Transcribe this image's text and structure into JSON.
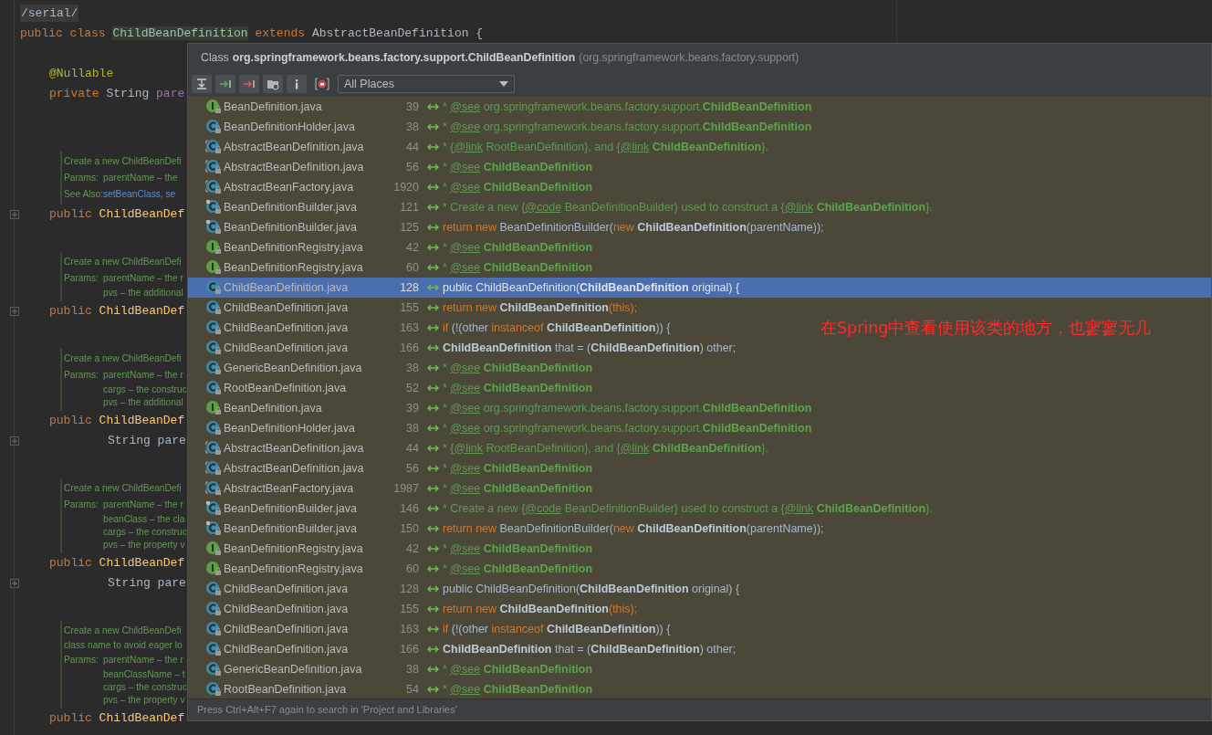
{
  "editor": {
    "lines": [
      {
        "kind": "top",
        "fold": false,
        "highlight": true,
        "segments": [
          {
            "kind": "p",
            "text": "/serial/"
          }
        ]
      },
      {
        "kind": "top",
        "fold": false,
        "highlight": false,
        "segments": [
          {
            "kind": "k",
            "text": "public class "
          },
          {
            "kind": "hl",
            "text": "ChildBeanDefinition"
          },
          {
            "kind": "k",
            "text": " extends "
          },
          {
            "kind": "p",
            "text": "AbstractBeanDefinition {"
          }
        ]
      },
      {
        "kind": "blank"
      },
      {
        "kind": "member",
        "fold": false,
        "highlight": false,
        "segments": [
          {
            "kind": "a",
            "text": "@Nullable"
          }
        ]
      },
      {
        "kind": "member",
        "fold": false,
        "highlight": false,
        "segments": [
          {
            "kind": "k",
            "text": "private "
          },
          {
            "kind": "p",
            "text": "String "
          },
          {
            "kind": "f",
            "text": "pare"
          }
        ]
      },
      {
        "kind": "blank"
      },
      {
        "kind": "blank"
      },
      {
        "kind": "doc",
        "lines": [
          {
            "kind": "text",
            "text": "Create a new ChildBeanDefi"
          },
          {
            "kind": "param",
            "label": "Params:",
            "text": "parentName – the"
          },
          {
            "kind": "link",
            "label": "See Also:",
            "text": "setBeanClass, se"
          }
        ]
      },
      {
        "kind": "member",
        "fold": true,
        "highlight": false,
        "segments": [
          {
            "kind": "k",
            "text": "public "
          },
          {
            "kind": "m",
            "text": "ChildBeanDef"
          }
        ]
      },
      {
        "kind": "blank"
      },
      {
        "kind": "doc",
        "lines": [
          {
            "kind": "text",
            "text": "Create a new ChildBeanDefi"
          },
          {
            "kind": "param",
            "label": "Params:",
            "text": "parentName – the r"
          },
          {
            "kind": "more",
            "text": "pvs – the additional"
          }
        ]
      },
      {
        "kind": "member",
        "fold": true,
        "highlight": false,
        "segments": [
          {
            "kind": "k",
            "text": "public "
          },
          {
            "kind": "m",
            "text": "ChildBeanDef"
          }
        ]
      },
      {
        "kind": "blank"
      },
      {
        "kind": "doc",
        "lines": [
          {
            "kind": "text",
            "text": "Create a new ChildBeanDefi"
          },
          {
            "kind": "param",
            "label": "Params:",
            "text": "parentName – the r"
          },
          {
            "kind": "more",
            "text": "cargs – the construc"
          },
          {
            "kind": "more",
            "text": "pvs – the additional"
          }
        ]
      },
      {
        "kind": "member",
        "fold": false,
        "highlight": false,
        "segments": [
          {
            "kind": "k",
            "text": "public "
          },
          {
            "kind": "m",
            "text": "ChildBeanDef"
          }
        ]
      },
      {
        "kind": "continued",
        "fold": true,
        "highlight": false,
        "segments": [
          {
            "kind": "p",
            "text": "String pare"
          }
        ]
      },
      {
        "kind": "blank"
      },
      {
        "kind": "doc",
        "lines": [
          {
            "kind": "text",
            "text": "Create a new ChildBeanDefi"
          },
          {
            "kind": "param",
            "label": "Params:",
            "text": "parentName – the r"
          },
          {
            "kind": "more",
            "text": "beanClass – the cla"
          },
          {
            "kind": "more",
            "text": "cargs – the construc"
          },
          {
            "kind": "more",
            "text": "pvs – the property v"
          }
        ]
      },
      {
        "kind": "member",
        "fold": false,
        "highlight": false,
        "segments": [
          {
            "kind": "k",
            "text": "public "
          },
          {
            "kind": "m",
            "text": "ChildBeanDef"
          }
        ]
      },
      {
        "kind": "continued",
        "fold": true,
        "highlight": false,
        "segments": [
          {
            "kind": "p",
            "text": "String pare"
          }
        ]
      },
      {
        "kind": "blank"
      },
      {
        "kind": "doc",
        "lines": [
          {
            "kind": "text",
            "text": "Create a new ChildBeanDefi"
          },
          {
            "kind": "wrapped",
            "text": "class name to avoid eager lo"
          },
          {
            "kind": "param",
            "label": "Params:",
            "text": "parentName – the r"
          },
          {
            "kind": "more",
            "text": "beanClassName – t"
          },
          {
            "kind": "more",
            "text": "cargs – the construc"
          },
          {
            "kind": "more",
            "text": "pvs – the property v"
          }
        ]
      },
      {
        "kind": "member",
        "fold": false,
        "highlight": false,
        "segments": [
          {
            "kind": "k",
            "text": "public "
          },
          {
            "kind": "m",
            "text": "ChildBeanDef"
          }
        ]
      }
    ]
  },
  "popup": {
    "header": {
      "kind": "Class",
      "name": "org.springframework.beans.factory.support.ChildBeanDefinition",
      "package": "(org.springframework.beans.factory.support)"
    },
    "scope": "All Places",
    "rows": [
      {
        "kind": "interface",
        "file": "BeanDefinition.java",
        "line": "39",
        "selected": false,
        "code": [
          {
            "kind": "c",
            "text": "* "
          },
          {
            "kind": "tag",
            "text": "@see"
          },
          {
            "kind": "c",
            "text": " org.springframework.beans.factory.support."
          },
          {
            "kind": "cb",
            "text": "ChildBeanDefinition"
          }
        ]
      },
      {
        "kind": "class",
        "file": "BeanDefinitionHolder.java",
        "line": "38",
        "selected": false,
        "code": [
          {
            "kind": "c",
            "text": "* "
          },
          {
            "kind": "tag",
            "text": "@see"
          },
          {
            "kind": "c",
            "text": " org.springframework.beans.factory.support."
          },
          {
            "kind": "cb",
            "text": "ChildBeanDefinition"
          }
        ]
      },
      {
        "kind": "abstract",
        "file": "AbstractBeanDefinition.java",
        "line": "44",
        "selected": false,
        "code": [
          {
            "kind": "c",
            "text": "* "
          },
          {
            "kind": "tag",
            "text": "{@link"
          },
          {
            "kind": "c",
            "text": " RootBeanDefinition}, and "
          },
          {
            "kind": "tag",
            "text": "{@link"
          },
          {
            "kind": "cb",
            "text": " ChildBeanDefinition"
          },
          {
            "kind": "c",
            "text": "}."
          }
        ]
      },
      {
        "kind": "abstract",
        "file": "AbstractBeanDefinition.java",
        "line": "56",
        "selected": false,
        "code": [
          {
            "kind": "c",
            "text": "* "
          },
          {
            "kind": "tag",
            "text": "@see"
          },
          {
            "kind": "cb",
            "text": " ChildBeanDefinition"
          }
        ]
      },
      {
        "kind": "abstract",
        "file": "AbstractBeanFactory.java",
        "line": "1920",
        "selected": false,
        "code": [
          {
            "kind": "c",
            "text": "* "
          },
          {
            "kind": "tag",
            "text": "@see"
          },
          {
            "kind": "cb",
            "text": " ChildBeanDefinition"
          }
        ]
      },
      {
        "kind": "final",
        "file": "BeanDefinitionBuilder.java",
        "line": "121",
        "selected": false,
        "code": [
          {
            "kind": "c",
            "text": "* Create a new "
          },
          {
            "kind": "tag",
            "text": "{@code"
          },
          {
            "kind": "c",
            "text": " BeanDefinitionBuilder} used to construct a "
          },
          {
            "kind": "tag",
            "text": "{@link"
          },
          {
            "kind": "cb",
            "text": " ChildBeanDefinition"
          },
          {
            "kind": "c",
            "text": "}."
          }
        ]
      },
      {
        "kind": "final",
        "file": "BeanDefinitionBuilder.java",
        "line": "125",
        "selected": false,
        "code": [
          {
            "kind": "k",
            "text": "return new "
          },
          {
            "kind": "p",
            "text": "BeanDefinitionBuilder("
          },
          {
            "kind": "k",
            "text": "new "
          },
          {
            "kind": "b",
            "text": "ChildBeanDefinition"
          },
          {
            "kind": "p",
            "text": "(parentName));"
          }
        ]
      },
      {
        "kind": "interface",
        "file": "BeanDefinitionRegistry.java",
        "line": "42",
        "selected": false,
        "code": [
          {
            "kind": "c",
            "text": "* "
          },
          {
            "kind": "tag",
            "text": "@see"
          },
          {
            "kind": "cb",
            "text": " ChildBeanDefinition"
          }
        ]
      },
      {
        "kind": "interface",
        "file": "BeanDefinitionRegistry.java",
        "line": "60",
        "selected": false,
        "code": [
          {
            "kind": "c",
            "text": "* "
          },
          {
            "kind": "tag",
            "text": "@see"
          },
          {
            "kind": "cb",
            "text": " ChildBeanDefinition"
          }
        ]
      },
      {
        "kind": "class",
        "file": "ChildBeanDefinition.java",
        "line": "128",
        "selected": true,
        "code": [
          {
            "kind": "p",
            "text": "public ChildBeanDefinition("
          },
          {
            "kind": "b",
            "text": "ChildBeanDefinition"
          },
          {
            "kind": "p",
            "text": " original) {"
          }
        ]
      },
      {
        "kind": "class",
        "file": "ChildBeanDefinition.java",
        "line": "155",
        "selected": false,
        "code": [
          {
            "kind": "k",
            "text": "return new "
          },
          {
            "kind": "b",
            "text": "ChildBeanDefinition"
          },
          {
            "kind": "k",
            "text": "(this);"
          }
        ]
      },
      {
        "kind": "class",
        "file": "ChildBeanDefinition.java",
        "line": "163",
        "selected": false,
        "code": [
          {
            "kind": "k",
            "text": "if "
          },
          {
            "kind": "p",
            "text": "(!(other "
          },
          {
            "kind": "k",
            "text": "instanceof "
          },
          {
            "kind": "b",
            "text": "ChildBeanDefinition"
          },
          {
            "kind": "p",
            "text": ")) {"
          }
        ]
      },
      {
        "kind": "class",
        "file": "ChildBeanDefinition.java",
        "line": "166",
        "selected": false,
        "code": [
          {
            "kind": "b",
            "text": "ChildBeanDefinition"
          },
          {
            "kind": "p",
            "text": " that = ("
          },
          {
            "kind": "b",
            "text": "ChildBeanDefinition"
          },
          {
            "kind": "p",
            "text": ") other;"
          }
        ]
      },
      {
        "kind": "class",
        "file": "GenericBeanDefinition.java",
        "line": "38",
        "selected": false,
        "code": [
          {
            "kind": "c",
            "text": "* "
          },
          {
            "kind": "tag",
            "text": "@see"
          },
          {
            "kind": "cb",
            "text": " ChildBeanDefinition"
          }
        ]
      },
      {
        "kind": "class",
        "file": "RootBeanDefinition.java",
        "line": "52",
        "selected": false,
        "code": [
          {
            "kind": "c",
            "text": "* "
          },
          {
            "kind": "tag",
            "text": "@see"
          },
          {
            "kind": "cb",
            "text": " ChildBeanDefinition"
          }
        ]
      },
      {
        "kind": "interface",
        "file": "BeanDefinition.java",
        "line": "39",
        "selected": false,
        "code": [
          {
            "kind": "c",
            "text": "* "
          },
          {
            "kind": "tag",
            "text": "@see"
          },
          {
            "kind": "c",
            "text": " org.springframework.beans.factory.support."
          },
          {
            "kind": "cb",
            "text": "ChildBeanDefinition"
          }
        ]
      },
      {
        "kind": "class",
        "file": "BeanDefinitionHolder.java",
        "line": "38",
        "selected": false,
        "code": [
          {
            "kind": "c",
            "text": "* "
          },
          {
            "kind": "tag",
            "text": "@see"
          },
          {
            "kind": "c",
            "text": " org.springframework.beans.factory.support."
          },
          {
            "kind": "cb",
            "text": "ChildBeanDefinition"
          }
        ]
      },
      {
        "kind": "abstract",
        "file": "AbstractBeanDefinition.java",
        "line": "44",
        "selected": false,
        "code": [
          {
            "kind": "c",
            "text": "* "
          },
          {
            "kind": "tag",
            "text": "{@link"
          },
          {
            "kind": "c",
            "text": " RootBeanDefinition}, and "
          },
          {
            "kind": "tag",
            "text": "{@link"
          },
          {
            "kind": "cb",
            "text": " ChildBeanDefinition"
          },
          {
            "kind": "c",
            "text": "}."
          }
        ]
      },
      {
        "kind": "abstract",
        "file": "AbstractBeanDefinition.java",
        "line": "56",
        "selected": false,
        "code": [
          {
            "kind": "c",
            "text": "* "
          },
          {
            "kind": "tag",
            "text": "@see"
          },
          {
            "kind": "cb",
            "text": " ChildBeanDefinition"
          }
        ]
      },
      {
        "kind": "abstract",
        "file": "AbstractBeanFactory.java",
        "line": "1987",
        "selected": false,
        "code": [
          {
            "kind": "c",
            "text": "* "
          },
          {
            "kind": "tag",
            "text": "@see"
          },
          {
            "kind": "cb",
            "text": " ChildBeanDefinition"
          }
        ]
      },
      {
        "kind": "final",
        "file": "BeanDefinitionBuilder.java",
        "line": "146",
        "selected": false,
        "code": [
          {
            "kind": "c",
            "text": "* Create a new "
          },
          {
            "kind": "tag",
            "text": "{@code"
          },
          {
            "kind": "c",
            "text": " BeanDefinitionBuilder} used to construct a "
          },
          {
            "kind": "tag",
            "text": "{@link"
          },
          {
            "kind": "cb",
            "text": " ChildBeanDefinition"
          },
          {
            "kind": "c",
            "text": "}."
          }
        ]
      },
      {
        "kind": "final",
        "file": "BeanDefinitionBuilder.java",
        "line": "150",
        "selected": false,
        "code": [
          {
            "kind": "k",
            "text": "return new "
          },
          {
            "kind": "p",
            "text": "BeanDefinitionBuilder("
          },
          {
            "kind": "k",
            "text": "new "
          },
          {
            "kind": "b",
            "text": "ChildBeanDefinition"
          },
          {
            "kind": "p",
            "text": "(parentName));"
          }
        ]
      },
      {
        "kind": "interface",
        "file": "BeanDefinitionRegistry.java",
        "line": "42",
        "selected": false,
        "code": [
          {
            "kind": "c",
            "text": "* "
          },
          {
            "kind": "tag",
            "text": "@see"
          },
          {
            "kind": "cb",
            "text": " ChildBeanDefinition"
          }
        ]
      },
      {
        "kind": "interface",
        "file": "BeanDefinitionRegistry.java",
        "line": "60",
        "selected": false,
        "code": [
          {
            "kind": "c",
            "text": "* "
          },
          {
            "kind": "tag",
            "text": "@see"
          },
          {
            "kind": "cb",
            "text": " ChildBeanDefinition"
          }
        ]
      },
      {
        "kind": "class",
        "file": "ChildBeanDefinition.java",
        "line": "128",
        "selected": false,
        "code": [
          {
            "kind": "p",
            "text": "public ChildBeanDefinition("
          },
          {
            "kind": "b",
            "text": "ChildBeanDefinition"
          },
          {
            "kind": "p",
            "text": " original) {"
          }
        ]
      },
      {
        "kind": "class",
        "file": "ChildBeanDefinition.java",
        "line": "155",
        "selected": false,
        "code": [
          {
            "kind": "k",
            "text": "return new "
          },
          {
            "kind": "b",
            "text": "ChildBeanDefinition"
          },
          {
            "kind": "k",
            "text": "(this);"
          }
        ]
      },
      {
        "kind": "class",
        "file": "ChildBeanDefinition.java",
        "line": "163",
        "selected": false,
        "code": [
          {
            "kind": "k",
            "text": "if "
          },
          {
            "kind": "p",
            "text": "(!(other "
          },
          {
            "kind": "k",
            "text": "instanceof "
          },
          {
            "kind": "b",
            "text": "ChildBeanDefinition"
          },
          {
            "kind": "p",
            "text": ")) {"
          }
        ]
      },
      {
        "kind": "class",
        "file": "ChildBeanDefinition.java",
        "line": "166",
        "selected": false,
        "code": [
          {
            "kind": "b",
            "text": "ChildBeanDefinition"
          },
          {
            "kind": "p",
            "text": " that = ("
          },
          {
            "kind": "b",
            "text": "ChildBeanDefinition"
          },
          {
            "kind": "p",
            "text": ") other;"
          }
        ]
      },
      {
        "kind": "class",
        "file": "GenericBeanDefinition.java",
        "line": "38",
        "selected": false,
        "code": [
          {
            "kind": "c",
            "text": "* "
          },
          {
            "kind": "tag",
            "text": "@see"
          },
          {
            "kind": "cb",
            "text": " ChildBeanDefinition"
          }
        ]
      },
      {
        "kind": "class",
        "file": "RootBeanDefinition.java",
        "line": "54",
        "selected": false,
        "code": [
          {
            "kind": "c",
            "text": "* "
          },
          {
            "kind": "tag",
            "text": "@see"
          },
          {
            "kind": "cb",
            "text": " ChildBeanDefinition"
          }
        ]
      }
    ],
    "annotation": "在Spring中查看使用该类的地方，也寥寥无几",
    "footer": "Press Ctrl+Alt+F7 again to search in 'Project and Libraries'"
  }
}
